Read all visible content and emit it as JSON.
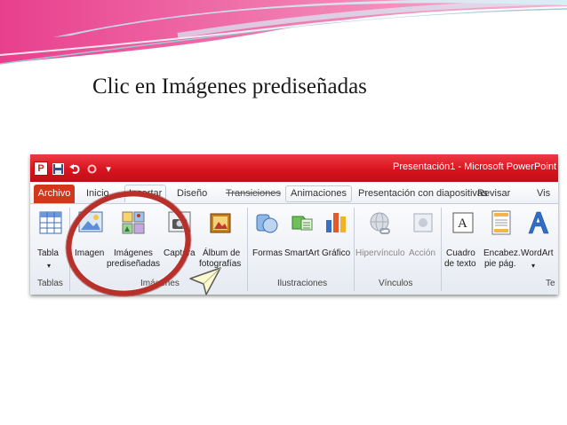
{
  "slide": {
    "title": "Clic en Imágenes prediseñadas"
  },
  "window": {
    "title": "Presentación1 - Microsoft PowerPoint (",
    "qat_separator": "▾"
  },
  "tabs": {
    "file": "Archivo",
    "home": "Inicio",
    "insert": "Insertar",
    "design": "Diseño",
    "transitions": "Transiciones",
    "animations": "Animaciones",
    "slideshow": "Presentación con diapositivas",
    "review": "Revisar",
    "view": "Vis"
  },
  "ribbon": {
    "tablas": {
      "table_label": "Tabla",
      "group_label": "Tablas"
    },
    "imagenes": {
      "imagen_label": "Imagen",
      "clipart_label_1": "Imágenes",
      "clipart_label_2": "prediseñadas",
      "captura_label": "Captura",
      "album_label_1": "Álbum de",
      "album_label_2": "fotografías",
      "group_label": "Imágenes"
    },
    "ilustraciones": {
      "formas_label": "Formas",
      "smartart_label": "SmartArt",
      "grafico_label": "Gráfico",
      "group_label": "Ilustraciones"
    },
    "vinculos": {
      "hipervinculo_label": "Hipervínculo",
      "accion_label": "Acción",
      "group_label": "Vínculos"
    },
    "texto": {
      "cuadro_label_1": "Cuadro",
      "cuadro_label_2": "de texto",
      "encabez_label_1": "Encabez.",
      "encabez_label_2": "pie pág.",
      "wordart_label": "WordArt",
      "group_label": "Te"
    }
  },
  "colors": {
    "titlebar": "#d8141e",
    "file_tab": "#d2371b",
    "annotation_ring": "#b8302a",
    "cursor_fill": "#fffbd0"
  }
}
